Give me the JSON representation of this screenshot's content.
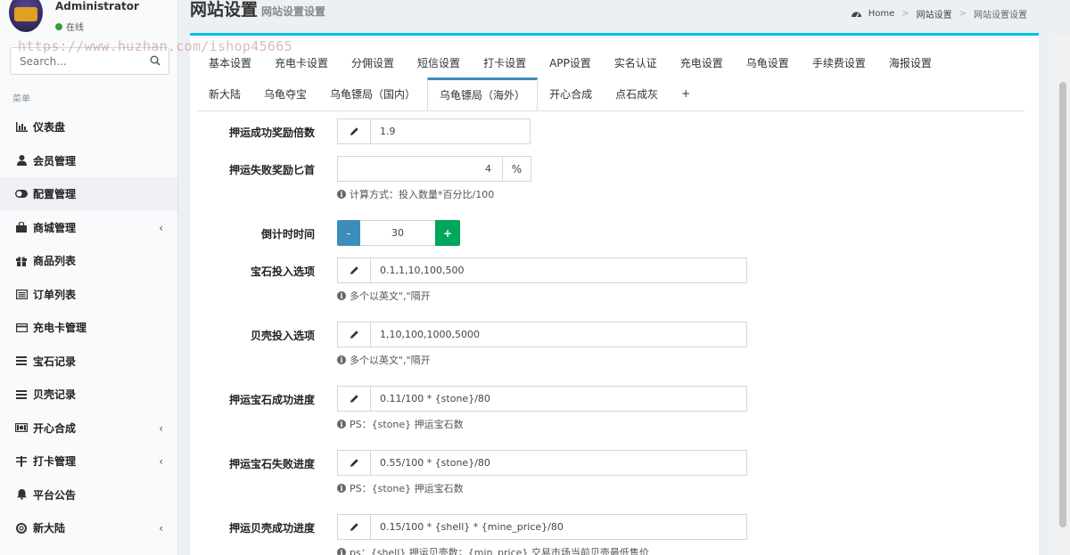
{
  "user": {
    "name": "Administrator",
    "status": "在线"
  },
  "search": {
    "placeholder": "Search..."
  },
  "menu": {
    "header": "菜单",
    "items": [
      {
        "label": "仪表盘",
        "icon": "bar-chart-icon"
      },
      {
        "label": "会员管理",
        "icon": "user-icon"
      },
      {
        "label": "配置管理",
        "icon": "toggle-icon",
        "active": true
      },
      {
        "label": "商城管理",
        "icon": "shopping-bag-icon",
        "chevron": true
      },
      {
        "label": "商品列表",
        "icon": "gift-icon"
      },
      {
        "label": "订单列表",
        "icon": "list-alt-icon"
      },
      {
        "label": "充电卡管理",
        "icon": "credit-card-icon"
      },
      {
        "label": "宝石记录",
        "icon": "bars-icon"
      },
      {
        "label": "贝壳记录",
        "icon": "bars-icon"
      },
      {
        "label": "开心合成",
        "icon": "money-icon",
        "chevron": true
      },
      {
        "label": "打卡管理",
        "icon": "sliders-icon",
        "chevron": true
      },
      {
        "label": "平台公告",
        "icon": "bell-icon"
      },
      {
        "label": "新大陆",
        "icon": "life-ring-icon",
        "chevron": true
      }
    ]
  },
  "page": {
    "title": "网站设置",
    "subtitle": "网站设置设置"
  },
  "breadcrumb": {
    "home": "Home",
    "level1": "网站设置",
    "level2": "网站设置设置"
  },
  "watermark": "https://www.huzhan.com/ishop45665",
  "tabs_row1": [
    "基本设置",
    "充电卡设置",
    "分佣设置",
    "短信设置",
    "打卡设置",
    "APP设置",
    "实名认证",
    "充电设置",
    "乌龟设置",
    "手续费设置",
    "海报设置"
  ],
  "tabs_row2": [
    "新大陆",
    "乌龟夺宝",
    "乌龟镖局（国内）",
    "乌龟镖局（海外）",
    "开心合成",
    "点石成灰",
    "+"
  ],
  "active_tab": "乌龟镖局（海外）",
  "form": {
    "f1": {
      "label": "押运成功奖励倍数",
      "value": "1.9"
    },
    "f2": {
      "label": "押运失败奖励匕首",
      "value": "4",
      "suffix": "%",
      "help": "计算方式：投入数量*百分比/100"
    },
    "f3": {
      "label": "倒计时时间",
      "value": "30",
      "minus": "-",
      "plus": "+"
    },
    "f4": {
      "label": "宝石投入选项",
      "value": "0.1,1,10,100,500",
      "help": "多个以英文\",\"隔开"
    },
    "f5": {
      "label": "贝壳投入选项",
      "value": "1,10,100,1000,5000",
      "help": "多个以英文\",\"隔开"
    },
    "f6": {
      "label": "押运宝石成功进度",
      "value": "0.11/100 * {stone}/80",
      "help": "PS：{stone} 押运宝石数"
    },
    "f7": {
      "label": "押运宝石失败进度",
      "value": "0.55/100 * {stone}/80",
      "help": "PS：{stone} 押运宝石数"
    },
    "f8": {
      "label": "押运贝壳成功进度",
      "value": "0.15/100 * {shell} * {mine_price}/80",
      "help": "ps：{shell} 押运贝壳数；{min_price} 交易市场当前贝壳最低售价"
    }
  },
  "colors": {
    "accent_blue": "#3c8dbc",
    "accent_green": "#00a65a",
    "box_top": "#00c0ef"
  }
}
